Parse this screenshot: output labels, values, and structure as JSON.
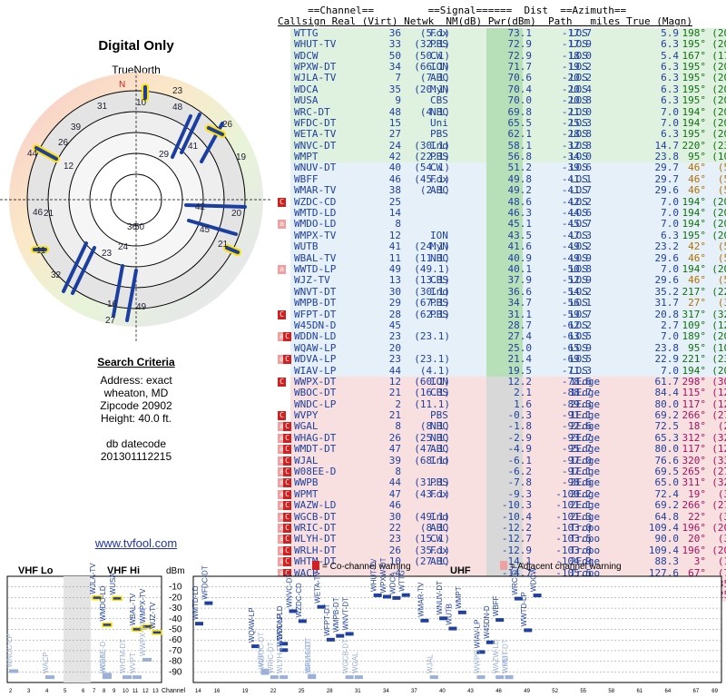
{
  "left": {
    "title": "Digital Only",
    "true_north": "TrueNorth",
    "north_marker": "N",
    "search_header": "Search Criteria",
    "address": "Address: exact",
    "city": "wheaton, MD",
    "zip": "Zipcode 20902",
    "height": "Height: 40.0 ft.",
    "db_label": "db datecode",
    "db_code": "201301112215",
    "site": "www.tvfool.com"
  },
  "table": {
    "header1": "     ==Channel==         ==Signal======  Dist  ==Azimuth==",
    "header2": "Callsign Real (Virt) Netwk  NM(dB) Pwr(dBm)  Path   miles True (Magn)",
    "rows": [
      {
        "call": "WTTG",
        "real": "36",
        "virt": "(5.1)",
        "net": "Fox",
        "nm": "73.1",
        "pwr": "-17.7",
        "path": "LOS",
        "dist": "5.9",
        "true": "198°",
        "magn": "(209°)",
        "bg": "#dff2df",
        "warn": ""
      },
      {
        "call": "WHUT-TV",
        "real": "33",
        "virt": "(32.1)",
        "net": "PBS",
        "nm": "72.9",
        "pwr": "-17.9",
        "path": "LOS",
        "dist": "6.3",
        "true": "195°",
        "magn": "(206°)",
        "bg": "#dff2df",
        "warn": ""
      },
      {
        "call": "WDCW",
        "real": "50",
        "virt": "(50.1)",
        "net": "CW",
        "nm": "72.9",
        "pwr": "-18.0",
        "path": "LOS",
        "dist": "5.4",
        "true": "167°",
        "magn": "(178°)",
        "bg": "#dff2df",
        "warn": ""
      },
      {
        "call": "WPXW-DT",
        "real": "34",
        "virt": "(66.1)",
        "net": "ION",
        "nm": "71.7",
        "pwr": "-19.2",
        "path": "LOS",
        "dist": "6.3",
        "true": "195°",
        "magn": "(206°)",
        "bg": "#dff2df",
        "warn": ""
      },
      {
        "call": "WJLA-TV",
        "real": "7",
        "virt": "(7.1)",
        "net": "ABC",
        "nm": "70.6",
        "pwr": "-20.2",
        "path": "LOS",
        "dist": "6.3",
        "true": "195°",
        "magn": "(206°)",
        "bg": "#dff2df",
        "warn": ""
      },
      {
        "call": "WDCA",
        "real": "35",
        "virt": "(20.1)",
        "net": "MyN",
        "nm": "70.4",
        "pwr": "-20.4",
        "path": "LOS",
        "dist": "6.3",
        "true": "195°",
        "magn": "(206°)",
        "bg": "#dff2df",
        "warn": ""
      },
      {
        "call": "WUSA",
        "real": "9",
        "virt": "",
        "net": "CBS",
        "nm": "70.0",
        "pwr": "-20.8",
        "path": "LOS",
        "dist": "6.3",
        "true": "195°",
        "magn": "(206°)",
        "bg": "#dff2df",
        "warn": ""
      },
      {
        "call": "WRC-DT",
        "real": "48",
        "virt": "(4.1)",
        "net": "NBC",
        "nm": "69.8",
        "pwr": "-21.0",
        "path": "LOS",
        "dist": "7.0",
        "true": "194°",
        "magn": "(205°)",
        "bg": "#dff2df",
        "warn": ""
      },
      {
        "call": "WFDC-DT",
        "real": "15",
        "virt": "",
        "net": "Uni",
        "nm": "65.5",
        "pwr": "-25.3",
        "path": "LOS",
        "dist": "7.0",
        "true": "194°",
        "magn": "(205°)",
        "bg": "#dff2df",
        "warn": ""
      },
      {
        "call": "WETA-TV",
        "real": "27",
        "virt": "",
        "net": "PBS",
        "nm": "62.1",
        "pwr": "-28.8",
        "path": "LOS",
        "dist": "6.3",
        "true": "195°",
        "magn": "(206°)",
        "bg": "#dff2df",
        "warn": ""
      },
      {
        "call": "WNVC-DT",
        "real": "24",
        "virt": "(30.1)",
        "net": "Ind",
        "nm": "58.1",
        "pwr": "-32.8",
        "path": "LOS",
        "dist": "14.7",
        "true": "220°",
        "magn": "(231°)",
        "bg": "#dff2df",
        "warn": ""
      },
      {
        "call": "WMPT",
        "real": "42",
        "virt": "(22.1)",
        "net": "PBS",
        "nm": "56.8",
        "pwr": "-34.0",
        "path": "LOS",
        "dist": "23.8",
        "true": "95°",
        "magn": "(105°)",
        "bg": "#dff2df",
        "warn": ""
      },
      {
        "call": "WNUV-DT",
        "real": "40",
        "virt": "(54.1)",
        "net": "CW",
        "nm": "51.2",
        "pwr": "-39.6",
        "path": "LOS",
        "dist": "29.7",
        "true": "46°",
        "magn": "(57°)",
        "bg": "#e6f0f8",
        "warn": ""
      },
      {
        "call": "WBFF",
        "real": "46",
        "virt": "(45.1)",
        "net": "Fox",
        "nm": "49.8",
        "pwr": "-41.1",
        "path": "LOS",
        "dist": "29.7",
        "true": "46°",
        "magn": "(57°)",
        "bg": "#e6f0f8",
        "warn": ""
      },
      {
        "call": "WMAR-TV",
        "real": "38",
        "virt": "(2.1)",
        "net": "ABC",
        "nm": "49.2",
        "pwr": "-41.7",
        "path": "LOS",
        "dist": "29.6",
        "true": "46°",
        "magn": "(57°)",
        "bg": "#e6f0f8",
        "warn": ""
      },
      {
        "call": "WZDC-CD",
        "real": "25",
        "virt": "",
        "net": "",
        "nm": "48.6",
        "pwr": "-42.2",
        "path": "LOS",
        "dist": "7.0",
        "true": "194°",
        "magn": "(205°)",
        "bg": "#e6f0f8",
        "warn": "C"
      },
      {
        "call": "WMTD-LD",
        "real": "14",
        "virt": "",
        "net": "",
        "nm": "46.3",
        "pwr": "-44.6",
        "path": "LOS",
        "dist": "7.0",
        "true": "194°",
        "magn": "(205°)",
        "bg": "#e6f0f8",
        "warn": ""
      },
      {
        "call": "WMDO-LD",
        "real": "8",
        "virt": "",
        "net": "",
        "nm": "45.1",
        "pwr": "-45.7",
        "path": "LOS",
        "dist": "7.0",
        "true": "194°",
        "magn": "(205°)",
        "bg": "#e6f0f8",
        "warn": "a"
      },
      {
        "call": "WMPX-TV",
        "real": "12",
        "virt": "",
        "net": "ION",
        "nm": "43.5",
        "pwr": "-47.3",
        "path": "LOS",
        "dist": "6.3",
        "true": "195°",
        "magn": "(206°)",
        "bg": "#e6f0f8",
        "warn": ""
      },
      {
        "call": "WUTB",
        "real": "41",
        "virt": "(24.1)",
        "net": "MyN",
        "nm": "41.6",
        "pwr": "-49.2",
        "path": "LOS",
        "dist": "23.2",
        "true": "42°",
        "magn": "(53°)",
        "bg": "#e6f0f8",
        "warn": ""
      },
      {
        "call": "WBAL-TV",
        "real": "11",
        "virt": "(11.1)",
        "net": "NBC",
        "nm": "40.9",
        "pwr": "-49.9",
        "path": "LOS",
        "dist": "29.6",
        "true": "46°",
        "magn": "(57°)",
        "bg": "#e6f0f8",
        "warn": ""
      },
      {
        "call": "WWTD-LP",
        "real": "49",
        "virt": "(49.1)",
        "net": "",
        "nm": "40.1",
        "pwr": "-50.8",
        "path": "LOS",
        "dist": "7.0",
        "true": "194°",
        "magn": "(205°)",
        "bg": "#e6f0f8",
        "warn": "a"
      },
      {
        "call": "WJZ-TV",
        "real": "13",
        "virt": "(13.1)",
        "net": "CBS",
        "nm": "37.9",
        "pwr": "-52.9",
        "path": "LOS",
        "dist": "29.6",
        "true": "46°",
        "magn": "(57°)",
        "bg": "#e6f0f8",
        "warn": ""
      },
      {
        "call": "WNVT-DT",
        "real": "30",
        "virt": "(30.1)",
        "net": "Ind",
        "nm": "36.6",
        "pwr": "-54.2",
        "path": "LOS",
        "dist": "35.2",
        "true": "217°",
        "magn": "(228°)",
        "bg": "#e6f0f8",
        "warn": ""
      },
      {
        "call": "WMPB-DT",
        "real": "29",
        "virt": "(67.1)",
        "net": "PBS",
        "nm": "34.7",
        "pwr": "-56.1",
        "path": "LOS",
        "dist": "31.7",
        "true": "27°",
        "magn": "(38°)",
        "bg": "#e6f0f8",
        "warn": ""
      },
      {
        "call": "WFPT-DT",
        "real": "28",
        "virt": "(62.1)",
        "net": "PBS",
        "nm": "31.1",
        "pwr": "-59.7",
        "path": "LOS",
        "dist": "20.8",
        "true": "317°",
        "magn": "(328°)",
        "bg": "#e6f0f8",
        "warn": "C"
      },
      {
        "call": "W45DN-D",
        "real": "45",
        "virt": "",
        "net": "",
        "nm": "28.7",
        "pwr": "-62.2",
        "path": "LOS",
        "dist": "2.7",
        "true": "109°",
        "magn": "(120°)",
        "bg": "#e6f0f8",
        "warn": ""
      },
      {
        "call": "WDDN-LD",
        "real": "23",
        "virt": "(23.1)",
        "net": "",
        "nm": "27.4",
        "pwr": "-63.5",
        "path": "LOS",
        "dist": "7.0",
        "true": "189°",
        "magn": "(200°)",
        "bg": "#e6f0f8",
        "warn": "aC"
      },
      {
        "call": "WQAW-LP",
        "real": "20",
        "virt": "",
        "net": "",
        "nm": "25.0",
        "pwr": "-65.9",
        "path": "LOS",
        "dist": "23.8",
        "true": "95°",
        "magn": "(105°)",
        "bg": "#e6f0f8",
        "warn": ""
      },
      {
        "call": "WDVA-LP",
        "real": "23",
        "virt": "(23.1)",
        "net": "",
        "nm": "21.4",
        "pwr": "-69.5",
        "path": "LOS",
        "dist": "22.9",
        "true": "221°",
        "magn": "(232°)",
        "bg": "#e6f0f8",
        "warn": "aC"
      },
      {
        "call": "WIAV-LP",
        "real": "44",
        "virt": "(4.1)",
        "net": "",
        "nm": "19.5",
        "pwr": "-71.3",
        "path": "LOS",
        "dist": "7.0",
        "true": "194°",
        "magn": "(205°)",
        "bg": "#e6f0f8",
        "warn": ""
      },
      {
        "call": "WWPX-DT",
        "real": "12",
        "virt": "(60.1)",
        "net": "ION",
        "nm": "12.2",
        "pwr": "-78.6",
        "path": "1Edge",
        "dist": "61.7",
        "true": "298°",
        "magn": "(309°)",
        "bg": "#f8e0e0",
        "warn": "C"
      },
      {
        "call": "WBOC-DT",
        "real": "21",
        "virt": "(16.1)",
        "net": "CBS",
        "nm": "2.1",
        "pwr": "-88.7",
        "path": "1Edge",
        "dist": "84.4",
        "true": "115°",
        "magn": "(126°)",
        "bg": "#f8e0e0",
        "warn": ""
      },
      {
        "call": "WNDC-LP",
        "real": "2",
        "virt": "(11.1)",
        "net": "",
        "nm": "1.6",
        "pwr": "-89.3",
        "path": "2Edge",
        "dist": "80.0",
        "true": "117°",
        "magn": "(128°)",
        "bg": "#f8e0e0",
        "warn": ""
      },
      {
        "call": "WVPY",
        "real": "21",
        "virt": "",
        "net": "PBS",
        "nm": "-0.3",
        "pwr": "-91.1",
        "path": "1Edge",
        "dist": "69.2",
        "true": "266°",
        "magn": "(277°)",
        "bg": "#f8e0e0",
        "warn": "C"
      },
      {
        "call": "WGAL",
        "real": "8",
        "virt": "(8.1)",
        "net": "NBC",
        "nm": "-1.8",
        "pwr": "-92.6",
        "path": "2Edge",
        "dist": "72.5",
        "true": "18°",
        "magn": "(29°)",
        "bg": "#f8e0e0",
        "warn": "aC"
      },
      {
        "call": "WHAG-DT",
        "real": "26",
        "virt": "(25.1)",
        "net": "NBC",
        "nm": "-2.9",
        "pwr": "-93.7",
        "path": "2Edge",
        "dist": "65.3",
        "true": "312°",
        "magn": "(322°)",
        "bg": "#f8e0e0",
        "warn": "aC"
      },
      {
        "call": "WMDT-DT",
        "real": "47",
        "virt": "(47.1)",
        "net": "ABC",
        "nm": "-4.9",
        "pwr": "-95.7",
        "path": "2Edge",
        "dist": "80.0",
        "true": "117°",
        "magn": "(128°)",
        "bg": "#f8e0e0",
        "warn": "aC"
      },
      {
        "call": "WJAL",
        "real": "39",
        "virt": "(68.1)",
        "net": "Ind",
        "nm": "-6.1",
        "pwr": "-97.0",
        "path": "1Edge",
        "dist": "76.6",
        "true": "320°",
        "magn": "(331°)",
        "bg": "#f8e0e0",
        "warn": "aC"
      },
      {
        "call": "W08EE-D",
        "real": "8",
        "virt": "",
        "net": "",
        "nm": "-6.2",
        "pwr": "-97.1",
        "path": "1Edge",
        "dist": "69.5",
        "true": "265°",
        "magn": "(276°)",
        "bg": "#f8e0e0",
        "warn": "aC"
      },
      {
        "call": "WWPB",
        "real": "44",
        "virt": "(31.1)",
        "net": "PBS",
        "nm": "-7.8",
        "pwr": "-98.6",
        "path": "2Edge",
        "dist": "65.0",
        "true": "311°",
        "magn": "(322°)",
        "bg": "#f8e0e0",
        "warn": "aC"
      },
      {
        "call": "WPMT",
        "real": "47",
        "virt": "(43.1)",
        "net": "Fox",
        "nm": "-9.3",
        "pwr": "-100.2",
        "path": "2Edge",
        "dist": "72.4",
        "true": "19°",
        "magn": "(30°)",
        "bg": "#f8e0e0",
        "warn": "aC"
      },
      {
        "call": "WAZW-LD",
        "real": "46",
        "virt": "",
        "net": "",
        "nm": "-10.3",
        "pwr": "-101.1",
        "path": "2Edge",
        "dist": "69.2",
        "true": "266°",
        "magn": "(277°)",
        "bg": "#f8e0e0",
        "warn": "aC"
      },
      {
        "call": "WGCB-DT",
        "real": "30",
        "virt": "(49.1)",
        "net": "Ind",
        "nm": "-10.4",
        "pwr": "-101.3",
        "path": "2Edge",
        "dist": "64.8",
        "true": "22°",
        "magn": "(33°)",
        "bg": "#f8e0e0",
        "warn": "aC"
      },
      {
        "call": "WRIC-DT",
        "real": "22",
        "virt": "(8.1)",
        "net": "ABC",
        "nm": "-12.2",
        "pwr": "-103.0",
        "path": "Tropo",
        "dist": "109.4",
        "true": "196°",
        "magn": "(207°)",
        "bg": "#f8e0e0",
        "warn": "aC"
      },
      {
        "call": "WLYH-DT",
        "real": "23",
        "virt": "(15.1)",
        "net": "CW",
        "nm": "-12.7",
        "pwr": "-103.5",
        "path": "Tropo",
        "dist": "90.0",
        "true": "20°",
        "magn": "(31°)",
        "bg": "#f8e0e0",
        "warn": "aC"
      },
      {
        "call": "WRLH-DT",
        "real": "26",
        "virt": "(35.1)",
        "net": "Fox",
        "nm": "-12.9",
        "pwr": "-103.8",
        "path": "Tropo",
        "dist": "109.4",
        "true": "196°",
        "magn": "(207°)",
        "bg": "#f8e0e0",
        "warn": "aC"
      },
      {
        "call": "WHTM-DT",
        "real": "10",
        "virt": "(27.1)",
        "net": "ABC",
        "nm": "-14.1",
        "pwr": "-104.9",
        "path": "2Edge",
        "dist": "88.3",
        "true": "3°",
        "magn": "(14°)",
        "bg": "#f8e0e0",
        "warn": "aC"
      },
      {
        "call": "WACP",
        "real": "4",
        "virt": "",
        "net": "",
        "nm": "-14.7",
        "pwr": "-105.5",
        "path": "Tropo",
        "dist": "127.6",
        "true": "67°",
        "magn": "(78°)",
        "bg": "#f8e0e0",
        "warn": "aC"
      },
      {
        "call": "WGAL",
        "real": "31",
        "virt": "",
        "net": "NBC",
        "nm": "-14.7",
        "pwr": "-105.5",
        "path": "2Edge",
        "dist": "67.6",
        "true": "340°",
        "magn": "(351°)",
        "bg": "#f8e0e0",
        "warn": "aC"
      },
      {
        "call": "WVPT",
        "real": "11",
        "virt": "",
        "net": "PBS",
        "nm": "-15.5",
        "pwr": "-106.4",
        "path": "2Edge",
        "dist": "136.6",
        "true": "245°",
        "magn": "(255°)",
        "bg": "#f8e0e0",
        "warn": "aC"
      }
    ]
  },
  "bottom": {
    "vhf_lo": "VHF Lo",
    "vhf_hi": "VHF Hi",
    "uhf": "UHF",
    "dbm": "dBm",
    "channel": "Channel",
    "cochannel": "= Co-channel warning",
    "adjacent": "= Adjacent channel warning",
    "dbm_ticks": [
      "-10",
      "-20",
      "-30",
      "-40",
      "-50",
      "-60",
      "-70",
      "-80",
      "-90"
    ],
    "ch_ticks": [
      "2",
      "3",
      "4",
      "5",
      "6",
      "7",
      "8",
      "9",
      "10",
      "11",
      "12",
      "13",
      "14",
      "16",
      "19",
      "22",
      "25",
      "28",
      "31",
      "34",
      "37",
      "40",
      "43",
      "46",
      "49",
      "52",
      "55",
      "58",
      "61",
      "64",
      "67",
      "69"
    ]
  },
  "colors": {
    "accent": "#2040a0",
    "cochannel": "#d02020",
    "adjacent": "#f0a0a0"
  }
}
